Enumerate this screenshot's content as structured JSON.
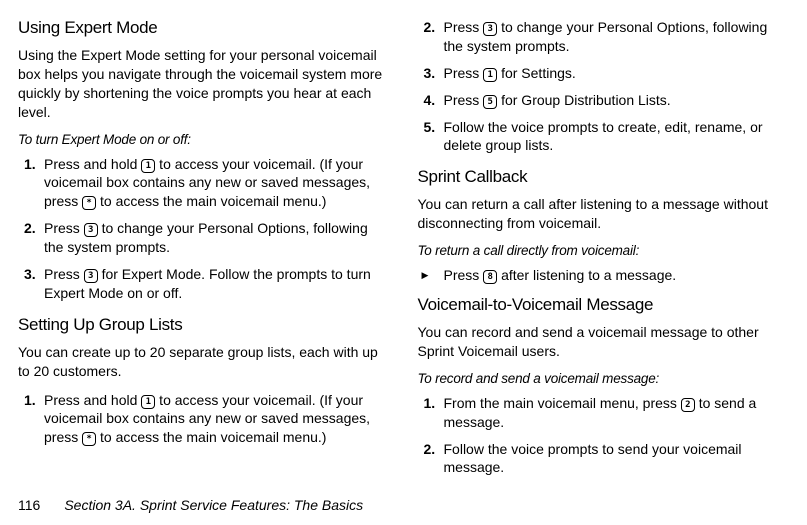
{
  "left": {
    "sec1": {
      "title": "Using Expert Mode",
      "intro": "Using the Expert Mode setting for your personal voicemail box helps you navigate through the voicemail system more quickly by shortening the voice prompts you hear at each level.",
      "subhead": "To turn Expert Mode on or off:",
      "steps": {
        "s1a": "Press and hold ",
        "s1b": " to access your voicemail. (If your voicemail box contains any new or saved messages, press ",
        "s1c": " to access the main voicemail menu.)",
        "s2a": "Press ",
        "s2b": " to change your Personal Options, following the system prompts.",
        "s3a": "Press ",
        "s3b": " for Expert Mode. Follow the prompts to turn Expert Mode on or off."
      }
    },
    "sec2": {
      "title": "Setting Up Group Lists",
      "intro": "You can create up to 20 separate group lists, each with up to 20 customers.",
      "steps": {
        "s1a": "Press and hold ",
        "s1b": " to access your voicemail. (If your voicemail box contains any new or saved messages, press ",
        "s1c": " to access the main voicemail menu.)"
      }
    }
  },
  "right": {
    "cont": {
      "s2a": "Press ",
      "s2b": " to change your Personal Options, following the system prompts.",
      "s3a": "Press ",
      "s3b": " for Settings.",
      "s4a": "Press ",
      "s4b": " for Group Distribution Lists.",
      "s5": "Follow the voice prompts to create, edit, rename, or delete group lists."
    },
    "sec3": {
      "title": "Sprint Callback",
      "intro": "You can return a call after listening to a message without disconnecting from voicemail.",
      "subhead": "To return a call directly from voicemail:",
      "b1a": "Press ",
      "b1b": " after listening to a message."
    },
    "sec4": {
      "title": "Voicemail-to-Voicemail Message",
      "intro": "You can record and send a voicemail message to other Sprint Voicemail users.",
      "subhead": "To record and send a voicemail message:",
      "s1a": "From the main voicemail menu, press ",
      "s1b": " to send a message.",
      "s2": "Follow the voice prompts to send your voicemail message."
    }
  },
  "keys": {
    "k1": "1",
    "kstar": "*",
    "k3": "3",
    "k5": "5",
    "k8": "8",
    "k2": "2"
  },
  "footer": {
    "page": "116",
    "title": "Section 3A. Sprint Service Features: The Basics"
  }
}
